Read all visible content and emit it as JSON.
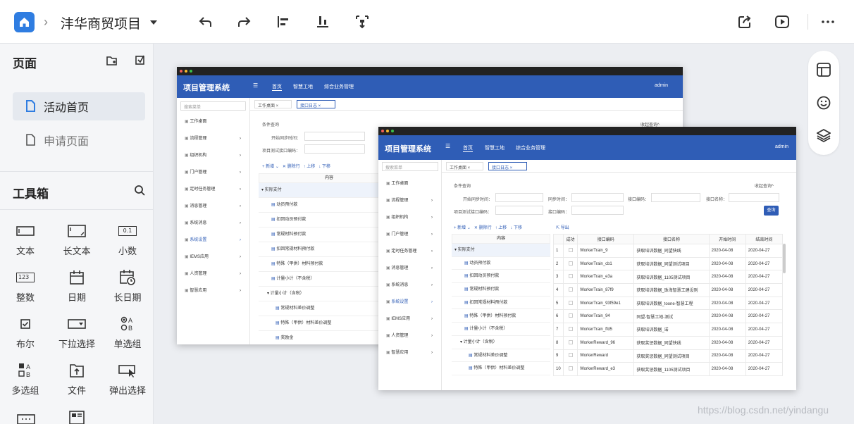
{
  "topbar": {
    "breadcrumb_sep": "›",
    "project_title": "沣华商贸项目",
    "colors": {
      "accent": "#2f7de1"
    },
    "icons": [
      "home-icon",
      "undo-icon",
      "redo-icon",
      "align-left-icon",
      "align-bottom-icon",
      "distribute-icon",
      "share-icon",
      "play-icon",
      "more-icon"
    ]
  },
  "pages": {
    "title": "页面",
    "items": [
      {
        "label": "活动首页",
        "active": true
      },
      {
        "label": "申请页面",
        "active": false
      }
    ]
  },
  "toolbox": {
    "title": "工具箱",
    "tools": [
      {
        "label": "文本",
        "icon": "text-field-icon"
      },
      {
        "label": "长文本",
        "icon": "textarea-icon"
      },
      {
        "label": "小数",
        "icon": "decimal-icon",
        "glyph": "0.1"
      },
      {
        "label": "整数",
        "icon": "integer-icon",
        "glyph": "123"
      },
      {
        "label": "日期",
        "icon": "calendar-icon"
      },
      {
        "label": "长日期",
        "icon": "datetime-icon"
      },
      {
        "label": "布尔",
        "icon": "checkbox-icon"
      },
      {
        "label": "下拉选择",
        "icon": "dropdown-icon"
      },
      {
        "label": "单选组",
        "icon": "radio-group-icon"
      },
      {
        "label": "多选组",
        "icon": "checkbox-group-icon"
      },
      {
        "label": "文件",
        "icon": "file-upload-icon"
      },
      {
        "label": "弹出选择",
        "icon": "popup-select-icon"
      }
    ]
  },
  "app": {
    "title": "项目管理系统",
    "nav": [
      "首页",
      "智慧工地",
      "综合业务管理"
    ],
    "user": "admin",
    "search_placeholder": "搜索菜单",
    "menu": [
      "工作桌面",
      "流程管理",
      "组织机构",
      "门户管理",
      "定时任务管理",
      "消息管理",
      "系统消息",
      "系统设置",
      "IEMS应用",
      "人资管理",
      "智慧应用"
    ],
    "tabs": [
      "工作桌面 ×",
      "接口日志 ×"
    ],
    "filter_title": "条件查询",
    "collapse": "收起查询^",
    "f_start": "开始同步时间：",
    "f_iface": "项目测试接口编码：",
    "f_sync": "同步时间：",
    "f_code": "接口编码：",
    "f_name": "接口名称：",
    "f_code2": "接口编码：",
    "query_btn": "查询",
    "actions": {
      "add": "+ 新增 ⌄",
      "del": "✕ 删除行",
      "up": "↑ 上移",
      "down": "↓ 下移",
      "export": "导出"
    },
    "content_header": "内容",
    "tree_back": [
      "▾ 实际支付",
      "动员预付款",
      "扣回动员预付款",
      "常规材料预付款",
      "扣回常规材料预付款",
      "特殊（甲供）材料预付款",
      "计量小计（不含税）",
      "▾ 计量小计（含税）",
      "常规材料差价调整",
      "特殊（甲供）材料差价调整",
      "奖励金"
    ],
    "tree_front": [
      "▾ 实际支付",
      "动员预付款",
      "扣回动员预付款",
      "常规材料预付款",
      "扣回常规材料预付款",
      "特殊（甲供）材料预付款",
      "计量小计（不含税）",
      "▾ 计量小计（含税）",
      "常规材料差价调整",
      "特殊（甲供）材料差价调整"
    ],
    "table_headers": [
      "成功",
      "接口编码",
      "接口名称",
      "开始时间",
      "结束时间"
    ],
    "rows": [
      [
        "1",
        "WorkerTrain_9",
        "获取培训数据_同望快线",
        "2020-04-08",
        "2020-04-27"
      ],
      [
        "2",
        "WorkerTrain_cb1",
        "获取培训数据_同望测试项目",
        "2020-04-08",
        "2020-04-27"
      ],
      [
        "3",
        "WorkerTrain_e3a",
        "获取培训数据_1105测试项目",
        "2020-04-08",
        "2020-04-27"
      ],
      [
        "4",
        "WorkerTrain_87f9",
        "获取培训数据_珠海智慧工建设则",
        "2020-04-08",
        "2020-04-27"
      ],
      [
        "5",
        "WorkerTrain_93f59e1",
        "获取培训数据_toone-智慧工程",
        "2020-04-08",
        "2020-04-27"
      ],
      [
        "6",
        "WorkerTrain_94",
        "同望-智慧工地-测试",
        "2020-04-08",
        "2020-04-27"
      ],
      [
        "7",
        "WorkerTrain_ffd5",
        "获取培训数据_诺",
        "2020-04-08",
        "2020-04-27"
      ],
      [
        "8",
        "WorkerReward_96",
        "获取奖惩数据_同望快线",
        "2020-04-08",
        "2020-04-27"
      ],
      [
        "9",
        "WorkerReward",
        "获取奖惩数据_同望测试项目",
        "2020-04-08",
        "2020-04-27"
      ],
      [
        "10",
        "WorkerReward_e3",
        "获取奖惩数据_1105测试项目",
        "2020-04-08",
        "2020-04-27"
      ]
    ],
    "colors": {
      "header": "#2f5db6",
      "selected_row": "#eef3fb"
    }
  },
  "watermark": "https://blog.csdn.net/yindangu"
}
